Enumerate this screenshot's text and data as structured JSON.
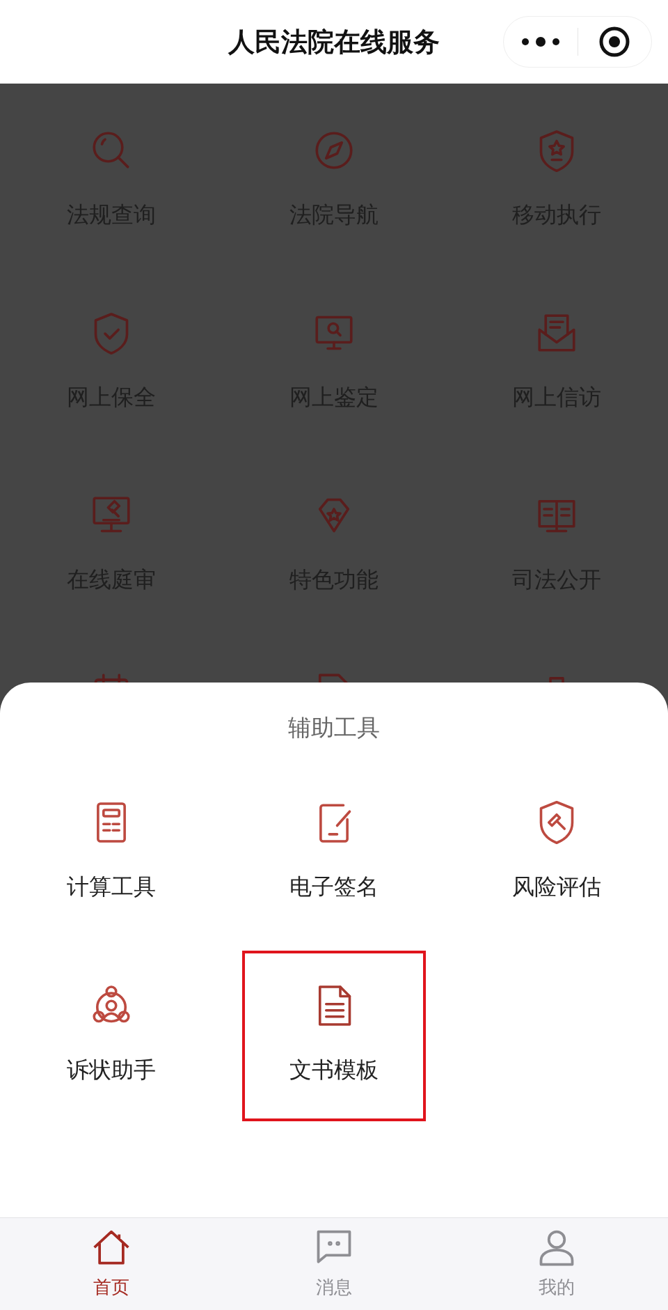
{
  "header": {
    "title": "人民法院在线服务"
  },
  "services": [
    {
      "label": "法规查询"
    },
    {
      "label": "法院导航"
    },
    {
      "label": "移动执行"
    },
    {
      "label": "网上保全"
    },
    {
      "label": "网上鉴定"
    },
    {
      "label": "网上信访"
    },
    {
      "label": "在线庭审"
    },
    {
      "label": "特色功能"
    },
    {
      "label": "司法公开"
    }
  ],
  "tool_sheet": {
    "title": "辅助工具",
    "items": [
      {
        "label": "计算工具",
        "highlighted": false
      },
      {
        "label": "电子签名",
        "highlighted": false
      },
      {
        "label": "风险评估",
        "highlighted": false
      },
      {
        "label": "诉状助手",
        "highlighted": false
      },
      {
        "label": "文书模板",
        "highlighted": true
      }
    ]
  },
  "tab_bar": [
    {
      "label": "首页",
      "selected": true
    },
    {
      "label": "消息",
      "selected": false
    },
    {
      "label": "我的",
      "selected": false
    }
  ]
}
